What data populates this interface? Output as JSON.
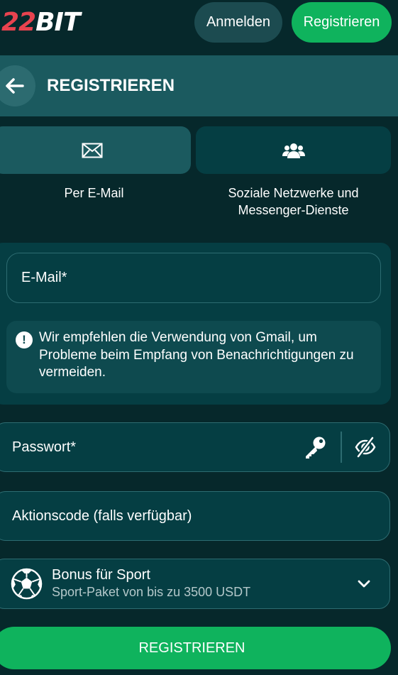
{
  "header": {
    "logo_number": "22",
    "logo_text": "BIT",
    "login_label": "Anmelden",
    "register_label": "Registrieren"
  },
  "titlebar": {
    "title": "REGISTRIEREN"
  },
  "methods": {
    "email_label": "Per E-Mail",
    "social_label_line1": "Soziale Netzwerke und",
    "social_label_line2": "Messenger-Dienste"
  },
  "form": {
    "email_placeholder": "E-Mail*",
    "notice_text": "Wir empfehlen die Verwendung von Gmail, um Probleme beim Empfang von Benachrichtigungen zu vermeiden.",
    "password_placeholder": "Passwort*",
    "promo_placeholder": "Aktionscode (falls verfügbar)",
    "bonus_title": "Bonus für Sport",
    "bonus_subtitle": "Sport-Paket von bis zu 3500 USDT",
    "submit_label": "REGISTRIEREN"
  },
  "icons": {
    "back": "arrow-left-icon",
    "email": "envelope-icon",
    "social": "users-icon",
    "notice": "exclamation-icon",
    "key": "key-icon",
    "visibility": "eye-slash-icon",
    "bonus": "soccer-ball-icon",
    "expand": "chevron-down-icon"
  },
  "colors": {
    "background": "#06282b",
    "panel": "#053e43",
    "titlebar": "#1b5a5f",
    "accent_green": "#0fb35d",
    "logo_red": "#e8434f"
  }
}
